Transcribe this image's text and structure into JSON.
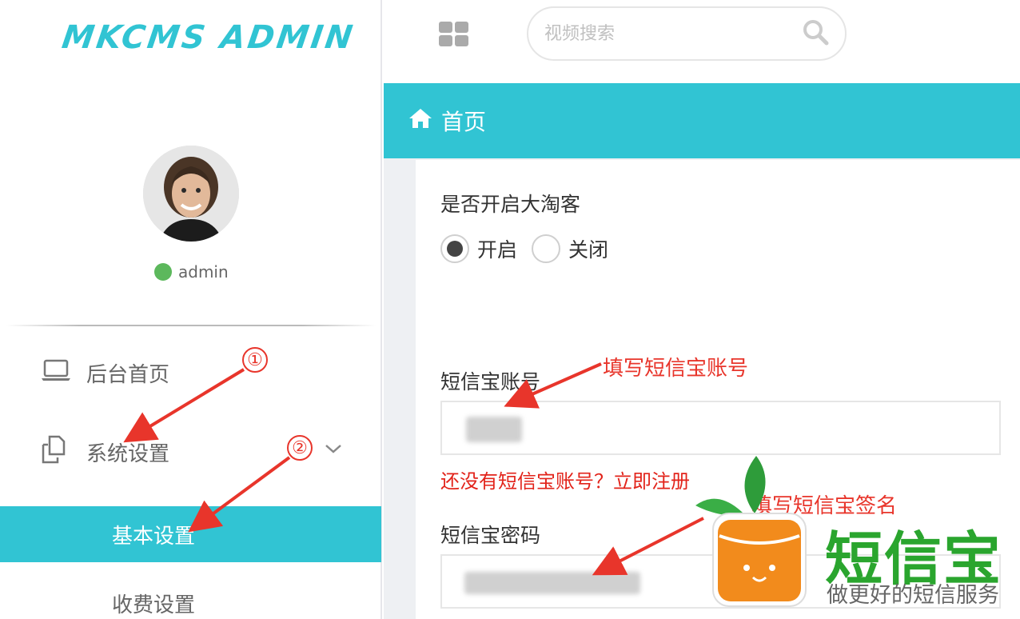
{
  "sidebar": {
    "logo": "MKCMS ADMIN",
    "user": {
      "name": "admin",
      "status_color": "#5cb85c"
    },
    "items": [
      {
        "label": "后台首页",
        "icon": "laptop-icon"
      },
      {
        "label": "系统设置",
        "icon": "copy-icon"
      }
    ],
    "sub_items": [
      {
        "label": "基本设置",
        "active": true
      },
      {
        "label": "收费设置",
        "active": false
      }
    ]
  },
  "topbar": {
    "search_placeholder": "视频搜索"
  },
  "breadcrumb": {
    "label": "首页",
    "icon": "home-icon"
  },
  "form": {
    "taoke_label": "是否开启大淘客",
    "taoke_options": [
      {
        "label": "开启",
        "checked": true
      },
      {
        "label": "关闭",
        "checked": false
      }
    ],
    "account_label": "短信宝账号",
    "register_link": "还没有短信宝账号？立即注册",
    "password_label": "短信宝密码"
  },
  "annotations": {
    "step1": "①",
    "step2": "②",
    "fill_account": "填写短信宝账号",
    "fill_sign": "填写短信宝签名"
  },
  "watermark": {
    "brand": "短信宝",
    "slogan": "做更好的短信服务"
  },
  "colors": {
    "accent": "#31c4d3",
    "annotation": "#e8352b",
    "brand_green": "#2aa52e",
    "link_red": "#e2231a"
  }
}
